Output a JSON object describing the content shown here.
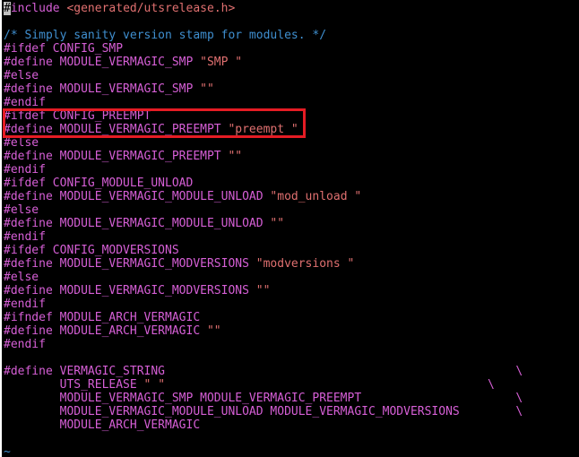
{
  "editor": {
    "lines": [
      {
        "parts": [
          {
            "t": "#",
            "c": "cursor"
          },
          {
            "t": "include ",
            "c": "directive"
          },
          {
            "t": "<generated/utsrelease.h>",
            "c": "string"
          }
        ]
      },
      {
        "parts": [
          {
            "t": "",
            "c": "plain"
          }
        ]
      },
      {
        "parts": [
          {
            "t": "/* Simply sanity version stamp for modules. */",
            "c": "comment"
          }
        ]
      },
      {
        "parts": [
          {
            "t": "#ifdef CONFIG_SMP",
            "c": "directive"
          }
        ]
      },
      {
        "parts": [
          {
            "t": "#define MODULE_VERMAGIC_SMP ",
            "c": "directive"
          },
          {
            "t": "\"SMP \"",
            "c": "string"
          }
        ]
      },
      {
        "parts": [
          {
            "t": "#else",
            "c": "directive"
          }
        ]
      },
      {
        "parts": [
          {
            "t": "#define MODULE_VERMAGIC_SMP ",
            "c": "directive"
          },
          {
            "t": "\"\"",
            "c": "string"
          }
        ]
      },
      {
        "parts": [
          {
            "t": "#endif",
            "c": "directive"
          }
        ]
      },
      {
        "parts": [
          {
            "t": "#ifdef CONFIG_PREEMPT",
            "c": "directive"
          }
        ]
      },
      {
        "parts": [
          {
            "t": "#define MODULE_VERMAGIC_PREEMPT ",
            "c": "directive"
          },
          {
            "t": "\"preempt \"",
            "c": "string"
          }
        ]
      },
      {
        "parts": [
          {
            "t": "#else",
            "c": "directive"
          }
        ]
      },
      {
        "parts": [
          {
            "t": "#define MODULE_VERMAGIC_PREEMPT ",
            "c": "directive"
          },
          {
            "t": "\"\"",
            "c": "string"
          }
        ]
      },
      {
        "parts": [
          {
            "t": "#endif",
            "c": "directive"
          }
        ]
      },
      {
        "parts": [
          {
            "t": "#ifdef CONFIG_MODULE_UNLOAD",
            "c": "directive"
          }
        ]
      },
      {
        "parts": [
          {
            "t": "#define MODULE_VERMAGIC_MODULE_UNLOAD ",
            "c": "directive"
          },
          {
            "t": "\"mod_unload \"",
            "c": "string"
          }
        ]
      },
      {
        "parts": [
          {
            "t": "#else",
            "c": "directive"
          }
        ]
      },
      {
        "parts": [
          {
            "t": "#define MODULE_VERMAGIC_MODULE_UNLOAD ",
            "c": "directive"
          },
          {
            "t": "\"\"",
            "c": "string"
          }
        ]
      },
      {
        "parts": [
          {
            "t": "#endif",
            "c": "directive"
          }
        ]
      },
      {
        "parts": [
          {
            "t": "#ifdef CONFIG_MODVERSIONS",
            "c": "directive"
          }
        ]
      },
      {
        "parts": [
          {
            "t": "#define MODULE_VERMAGIC_MODVERSIONS ",
            "c": "directive"
          },
          {
            "t": "\"modversions \"",
            "c": "string"
          }
        ]
      },
      {
        "parts": [
          {
            "t": "#else",
            "c": "directive"
          }
        ]
      },
      {
        "parts": [
          {
            "t": "#define MODULE_VERMAGIC_MODVERSIONS ",
            "c": "directive"
          },
          {
            "t": "\"\"",
            "c": "string"
          }
        ]
      },
      {
        "parts": [
          {
            "t": "#endif",
            "c": "directive"
          }
        ]
      },
      {
        "parts": [
          {
            "t": "#ifndef MODULE_ARCH_VERMAGIC",
            "c": "directive"
          }
        ]
      },
      {
        "parts": [
          {
            "t": "#define MODULE_ARCH_VERMAGIC ",
            "c": "directive"
          },
          {
            "t": "\"\"",
            "c": "string"
          }
        ]
      },
      {
        "parts": [
          {
            "t": "#endif",
            "c": "directive"
          }
        ]
      },
      {
        "parts": [
          {
            "t": "",
            "c": "plain"
          }
        ]
      },
      {
        "parts": [
          {
            "t": "#define VERMAGIC_STRING                                                  \\",
            "c": "directive"
          }
        ]
      },
      {
        "parts": [
          {
            "t": "        UTS_RELEASE ",
            "c": "directive"
          },
          {
            "t": "\" \"",
            "c": "string"
          },
          {
            "t": "                                              \\",
            "c": "directive"
          }
        ]
      },
      {
        "parts": [
          {
            "t": "        MODULE_VERMAGIC_SMP MODULE_VERMAGIC_PREEMPT                      \\",
            "c": "directive"
          }
        ]
      },
      {
        "parts": [
          {
            "t": "        MODULE_VERMAGIC_MODULE_UNLOAD MODULE_VERMAGIC_MODVERSIONS        \\",
            "c": "directive"
          }
        ]
      },
      {
        "parts": [
          {
            "t": "        MODULE_ARCH_VERMAGIC",
            "c": "directive"
          }
        ]
      },
      {
        "parts": [
          {
            "t": "",
            "c": "plain"
          }
        ]
      },
      {
        "parts": [
          {
            "t": "~",
            "c": "tilde"
          }
        ]
      }
    ]
  },
  "colors": {
    "background": "#000000",
    "directive": "#d65fd6",
    "string": "#e07070",
    "comment": "#3f8fd0",
    "highlight_border": "#e51c24"
  }
}
